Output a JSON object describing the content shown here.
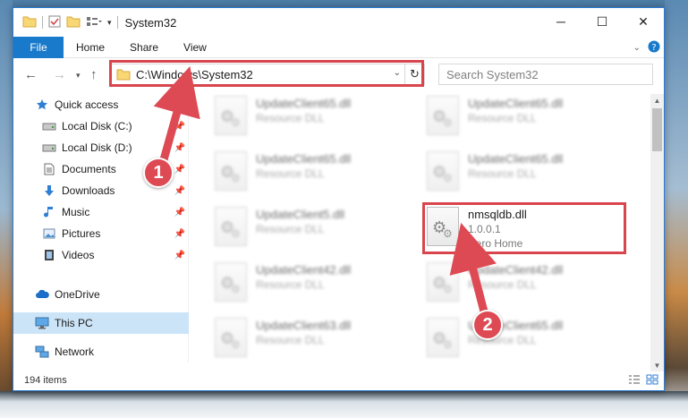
{
  "window": {
    "title": "System32",
    "controls": {
      "minimize": "─",
      "maximize": "☐",
      "close": "✕"
    }
  },
  "ribbon": {
    "tabs": [
      "File",
      "Home",
      "Share",
      "View"
    ]
  },
  "address_bar": {
    "path": "C:\\Windows\\System32",
    "search_placeholder": "Search System32"
  },
  "nav_pane": {
    "items": [
      {
        "label": "Quick access",
        "icon": "star-icon",
        "pinned": false
      },
      {
        "label": "Local Disk (C:)",
        "icon": "drive-icon",
        "pinned": true
      },
      {
        "label": "Local Disk (D:)",
        "icon": "drive-icon",
        "pinned": true
      },
      {
        "label": "Documents",
        "icon": "document-icon",
        "pinned": true
      },
      {
        "label": "Downloads",
        "icon": "download-icon",
        "pinned": true
      },
      {
        "label": "Music",
        "icon": "music-icon",
        "pinned": true
      },
      {
        "label": "Pictures",
        "icon": "pictures-icon",
        "pinned": true
      },
      {
        "label": "Videos",
        "icon": "videos-icon",
        "pinned": true
      },
      {
        "label": "OneDrive",
        "icon": "cloud-icon",
        "pinned": false
      },
      {
        "label": "This PC",
        "icon": "computer-icon",
        "pinned": false,
        "selected": true
      },
      {
        "label": "Network",
        "icon": "network-icon",
        "pinned": false
      }
    ]
  },
  "files": [
    {
      "name": "UpdateClient65.dll",
      "subtitle": "Resource DLL",
      "blurred": true
    },
    {
      "name": "UpdateClient65.dll",
      "subtitle": "Resource DLL",
      "blurred": true
    },
    {
      "name": "UpdateClient65.dll",
      "subtitle": "Resource DLL",
      "blurred": true
    },
    {
      "name": "UpdateClient65.dll",
      "subtitle": "Resource DLL",
      "blurred": true
    },
    {
      "name": "UpdateClient5.dll",
      "subtitle": "Resource DLL",
      "blurred": true
    },
    {
      "name": "nmsqldb.dll",
      "subtitle": "1.0.0.1",
      "subtitle2": "Nero Home",
      "blurred": false
    },
    {
      "name": "UpdateClient42.dll",
      "subtitle": "Resource DLL",
      "blurred": true
    },
    {
      "name": "UpdateClient42.dll",
      "subtitle": "Resource DLL",
      "blurred": true
    },
    {
      "name": "UpdateClient63.dll",
      "subtitle": "Resource DLL",
      "blurred": true
    },
    {
      "name": "UpdateClient65.dll",
      "subtitle": "Resource DLL",
      "blurred": true
    }
  ],
  "status": {
    "item_count": "194 items"
  },
  "callouts": {
    "one": "1",
    "two": "2"
  },
  "colors": {
    "accent": "#1979ca",
    "highlight": "#d9454d",
    "selected": "#cce4f7"
  }
}
